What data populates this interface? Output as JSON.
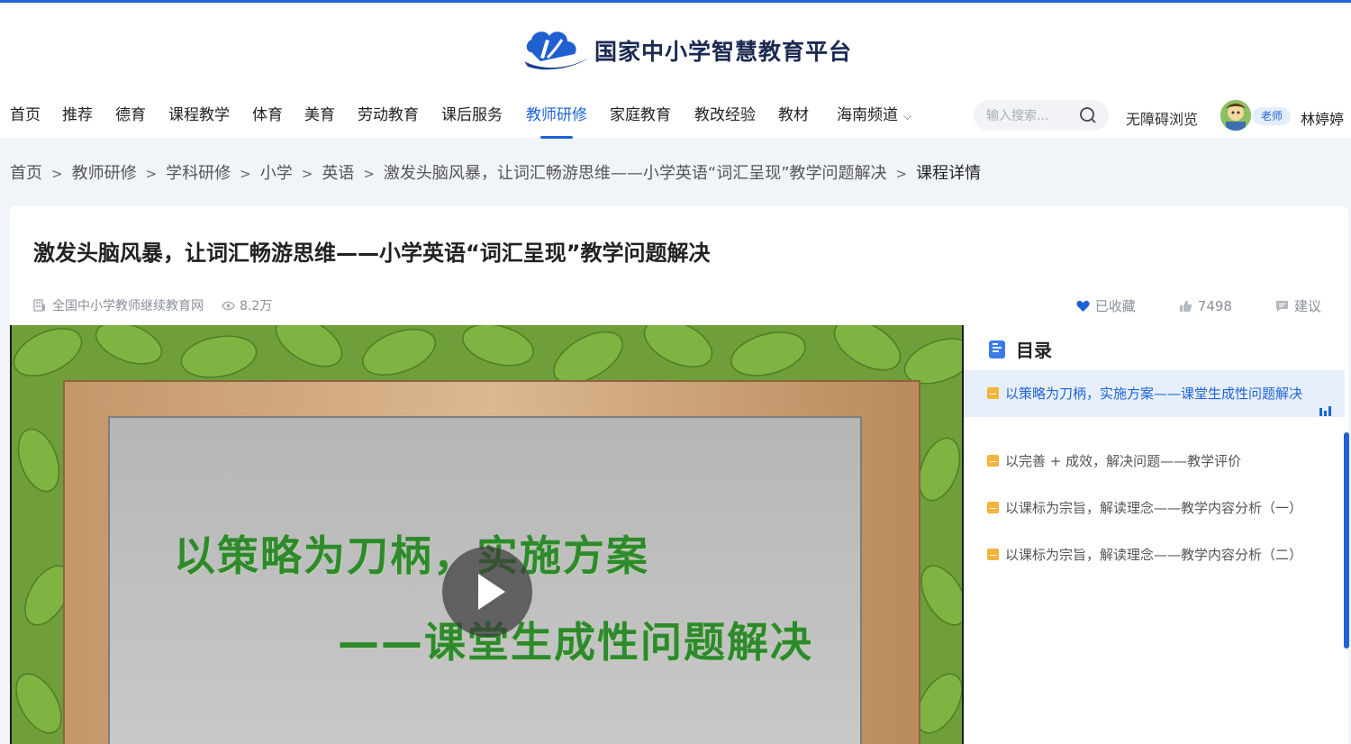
{
  "header": {
    "logo_text": "国家中小学智慧教育平台",
    "nav": [
      {
        "label": "首页"
      },
      {
        "label": "推荐"
      },
      {
        "label": "德育"
      },
      {
        "label": "课程教学"
      },
      {
        "label": "体育"
      },
      {
        "label": "美育"
      },
      {
        "label": "劳动教育"
      },
      {
        "label": "课后服务"
      },
      {
        "label": "教师研修",
        "active": true
      },
      {
        "label": "家庭教育"
      },
      {
        "label": "教改经验"
      },
      {
        "label": "教材"
      },
      {
        "label": "海南频道"
      }
    ],
    "search_placeholder": "输入搜索...",
    "accessible_label": "无障碍浏览",
    "role_badge": "老师",
    "username": "林婷婷"
  },
  "breadcrumb": {
    "items": [
      "首页",
      "教师研修",
      "学科研修",
      "小学",
      "英语",
      "激发头脑风暴，让词汇畅游思维——小学英语“词汇呈现”教学问题解决"
    ],
    "separator": ">",
    "current": "课程详情"
  },
  "course": {
    "title": "激发头脑风暴，让词汇畅游思维——小学英语“词汇呈现”教学问题解决",
    "source": "全国中小学教师继续教育网",
    "views": "8.2万",
    "favorite_label": "已收藏",
    "likes": "7498",
    "suggest_label": "建议"
  },
  "video": {
    "line1": "以策略为刀柄，实施方案",
    "line2": "——课堂生成性问题解决"
  },
  "toc": {
    "title": "目录",
    "items": [
      {
        "label": "以策略为刀柄，实施方案——课堂生成性问题解决",
        "active": true
      },
      {
        "label": "以完善 + 成效，解决问题——教学评价"
      },
      {
        "label": "以课标为宗旨，解读理念——教学内容分析（一）"
      },
      {
        "label": "以课标为宗旨，解读理念——教学内容分析（二）"
      }
    ]
  },
  "colors": {
    "brand": "#1e63d6",
    "page_bg": "#f1f4f9",
    "toc_active_bg": "#e7effc",
    "toc_icon": "#f2b43b",
    "video_text": "#2e8a2c"
  },
  "icons": {
    "search": "search-icon",
    "avatar": "avatar",
    "favorite": "heart-icon",
    "like": "thumbs-up-icon",
    "suggest": "comment-icon",
    "source": "building-icon",
    "views": "eye-icon",
    "toc": "document-icon",
    "play": "play-icon",
    "playing": "audio-bars-icon"
  }
}
